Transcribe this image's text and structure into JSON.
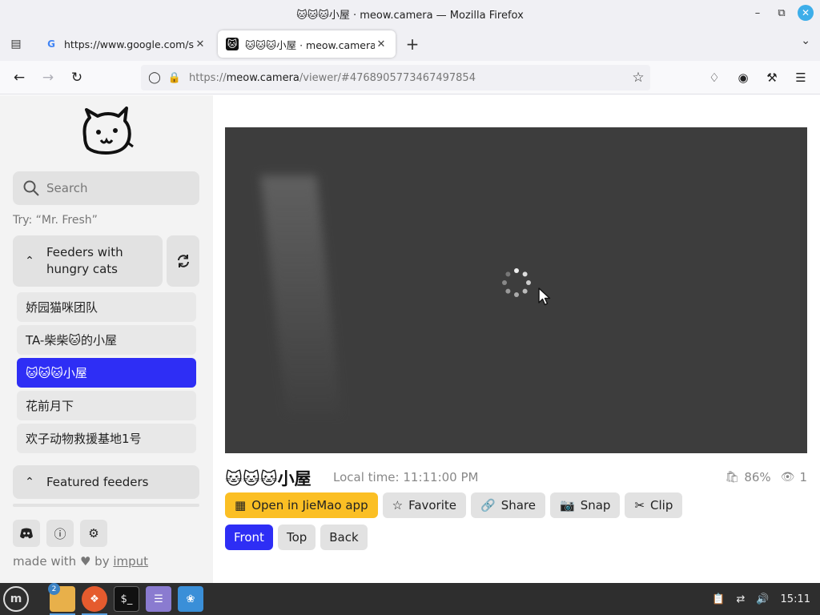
{
  "window": {
    "title": "🐱🐱🐱小屋 · meow.camera — Mozilla Firefox",
    "minimize_icon": "minimize-icon",
    "maximize_icon": "restore-icon",
    "close_icon": "close-icon"
  },
  "tabs": [
    {
      "title": "https://www.google.com/se",
      "favicon": "google-icon",
      "active": false
    },
    {
      "title": "🐱🐱🐱小屋 · meow.camera",
      "favicon": "meow-camera-icon",
      "active": true
    }
  ],
  "address_bar": {
    "url_prefix": "https://",
    "url_host": "meow.camera",
    "url_path": "/viewer/#4768905773467497854"
  },
  "sidebar": {
    "search_placeholder": "Search",
    "try_hint": "Try: “Mr. Fresh”",
    "group_hungry": {
      "label_line1": "Feeders with",
      "label_line2": "hungry cats",
      "expanded": true
    },
    "feeders": [
      {
        "name": "娇园猫咪团队",
        "selected": false
      },
      {
        "name": "TA-柴柴🐱的小屋",
        "selected": false
      },
      {
        "name": "🐱🐱🐱小屋",
        "selected": true
      },
      {
        "name": "花前月下",
        "selected": false
      },
      {
        "name": "欢子动物救援基地1号",
        "selected": false
      }
    ],
    "group_featured": {
      "label": "Featured feeders",
      "expanded": true
    },
    "made_with_prefix": "made with",
    "made_with_by": "by",
    "made_with_author": "imput"
  },
  "camera": {
    "title": "🐱🐱🐱小屋",
    "local_time": "Local time: 11:11:00 PM",
    "food_level": "86%",
    "viewers": "1",
    "loading": true
  },
  "actions": {
    "open_app": "Open in JieMao app",
    "favorite": "Favorite",
    "share": "Share",
    "snap": "Snap",
    "clip": "Clip"
  },
  "views": {
    "front": "Front",
    "top": "Top",
    "back": "Back",
    "active": "Front"
  },
  "taskbar": {
    "files_badge": "2",
    "clock": "15:11"
  },
  "colors": {
    "accent_blue": "#2e2ef5",
    "app_button_yellow": "#fbbf24",
    "video_bg": "#3d3d3d"
  }
}
